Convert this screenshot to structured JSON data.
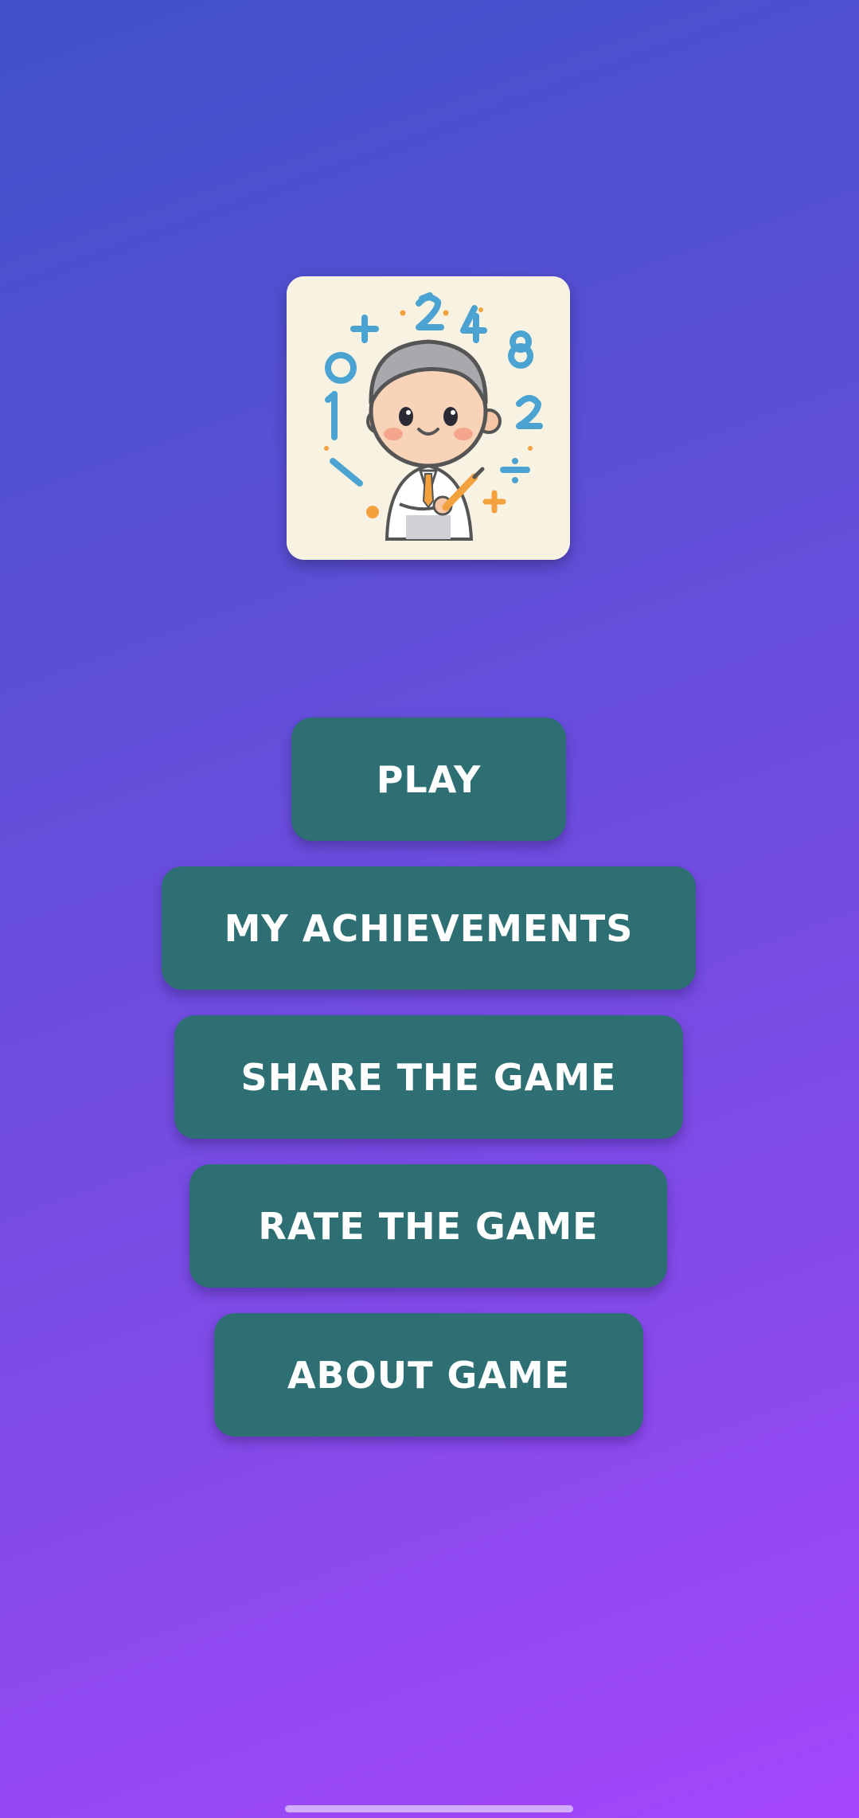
{
  "logo": {
    "icon": "math-teacher-logo-icon"
  },
  "menu": {
    "play_label": "PLAY",
    "achievements_label": "MY ACHIEVEMENTS",
    "share_label": "SHARE THE GAME",
    "rate_label": "RATE THE GAME",
    "about_label": "ABOUT GAME"
  },
  "colors": {
    "button": "#2e6f73",
    "gradient_top": "#4152c9",
    "gradient_bottom": "#a546fb",
    "logo_background": "#f8f2e3"
  }
}
